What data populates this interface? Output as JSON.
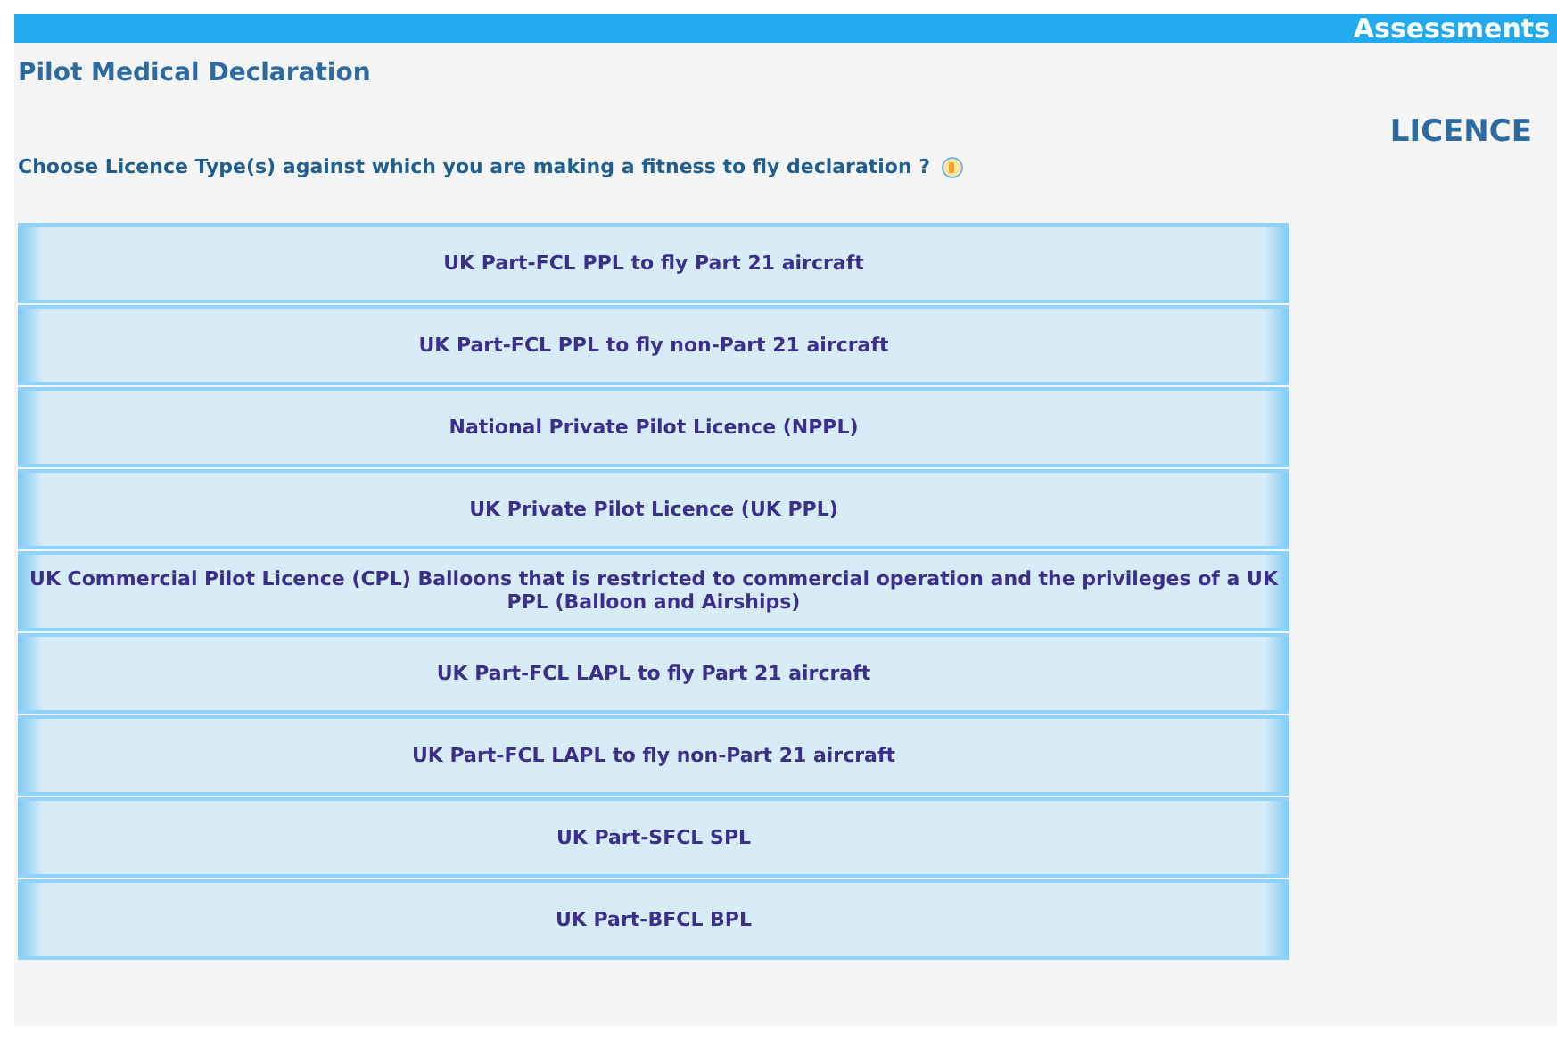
{
  "header": {
    "title": "Assessments"
  },
  "page_title": "Pilot Medical Declaration",
  "section_heading": "LICENCE",
  "question": "Choose Licence Type(s) against which you are making a fitness to fly declaration ?",
  "licence_options": [
    {
      "label": "UK Part-FCL PPL to fly Part 21 aircraft"
    },
    {
      "label": "UK Part-FCL PPL to fly non-Part 21 aircraft"
    },
    {
      "label": "National Private Pilot Licence (NPPL)"
    },
    {
      "label": "UK Private Pilot Licence (UK PPL)"
    },
    {
      "label": "UK Commercial Pilot Licence (CPL) Balloons that is restricted to commercial operation and the privileges of a UK PPL (Balloon and Airships)"
    },
    {
      "label": "UK Part-FCL LAPL to fly Part 21 aircraft"
    },
    {
      "label": "UK Part-FCL LAPL to fly non-Part 21 aircraft"
    },
    {
      "label": "UK Part-SFCL SPL"
    },
    {
      "label": "UK Part-BFCL BPL"
    }
  ]
}
